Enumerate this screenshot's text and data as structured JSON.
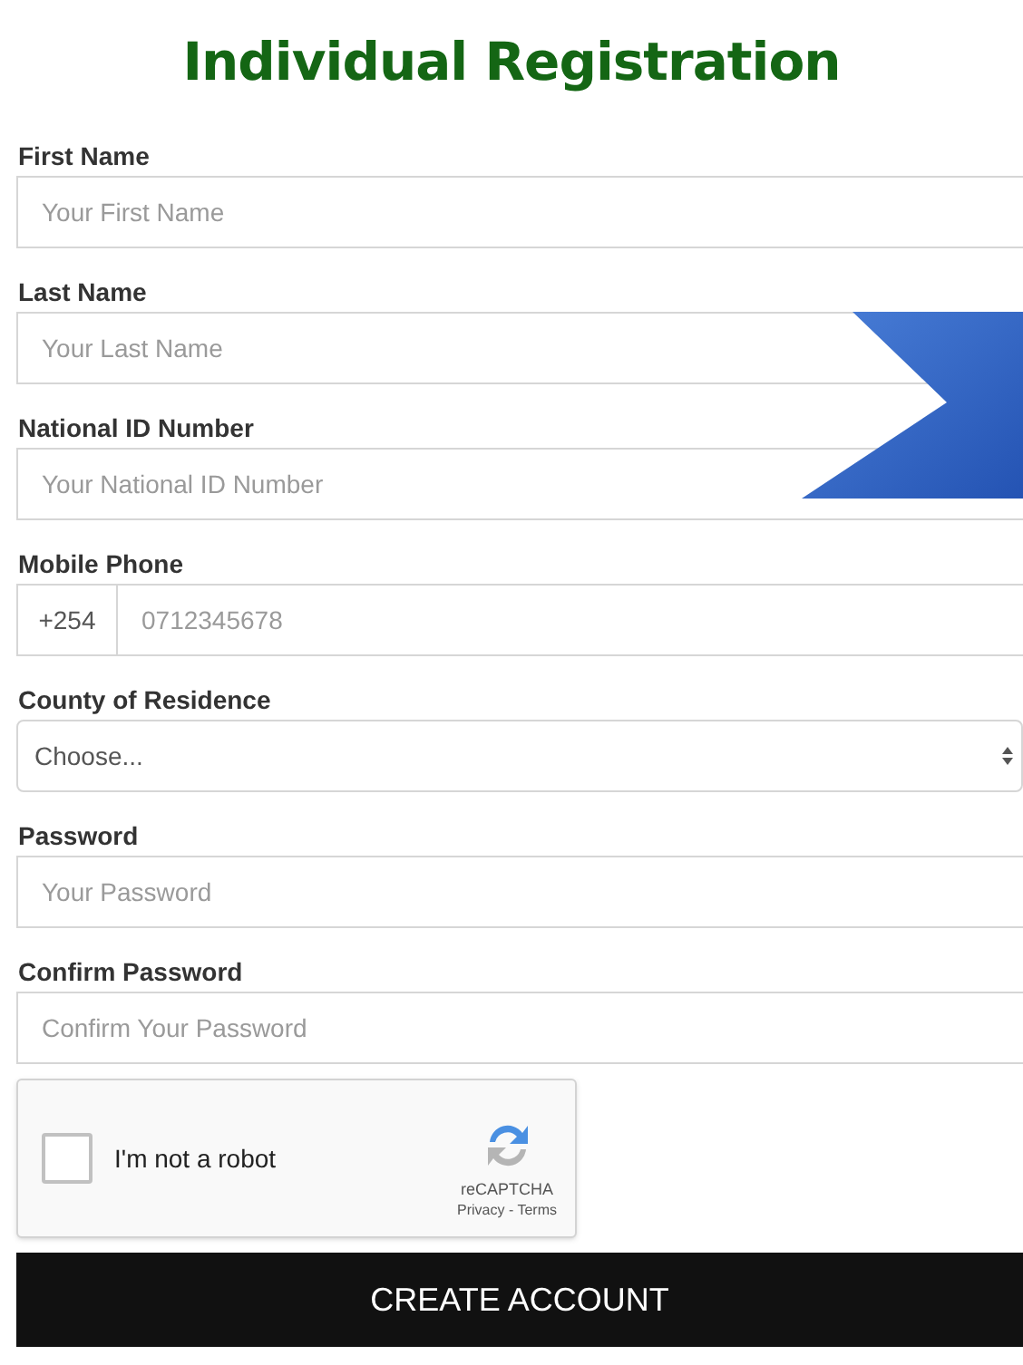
{
  "title": "Individual Registration",
  "fields": [
    {
      "kind": "text",
      "label": "First Name",
      "placeholder": "Your First Name"
    },
    {
      "kind": "text",
      "label": "Last Name",
      "placeholder": "Your Last Name"
    },
    {
      "kind": "text",
      "label": "National ID Number",
      "placeholder": "Your National ID Number"
    },
    {
      "kind": "phone",
      "label": "Mobile Phone",
      "prefix": "+254",
      "placeholder": "0712345678"
    },
    {
      "kind": "select",
      "label": "County of Residence",
      "value": "Choose..."
    },
    {
      "kind": "password",
      "label": "Password",
      "placeholder": "Your Password"
    },
    {
      "kind": "password",
      "label": "Confirm Password",
      "placeholder": "Confirm Your Password"
    }
  ],
  "captcha": {
    "label": "I'm not a robot",
    "checked": false,
    "brand": "reCAPTCHA",
    "links": "Privacy - Terms"
  },
  "submit": "CREATE ACCOUNT"
}
